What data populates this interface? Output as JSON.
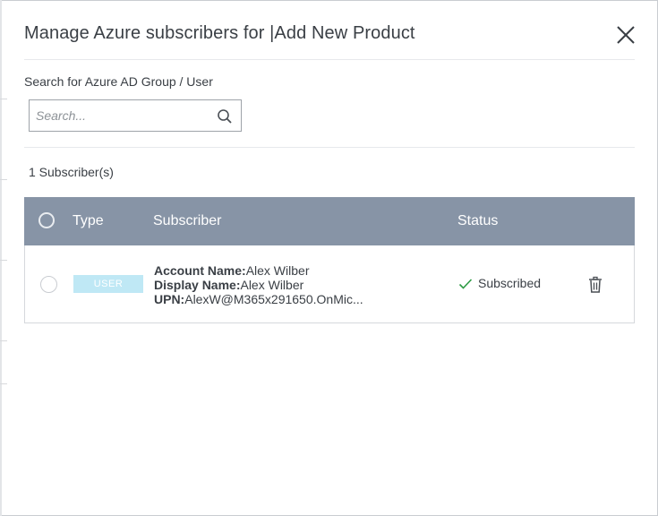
{
  "dialog": {
    "title": "Manage Azure subscribers for |Add New Product"
  },
  "search": {
    "label": "Search for Azure AD Group / User",
    "placeholder": "Search...",
    "value": ""
  },
  "subscribers": {
    "count_label": "1 Subscriber(s)",
    "columns": {
      "type": "Type",
      "subscriber": "Subscriber",
      "status": "Status"
    },
    "rows": [
      {
        "type_badge": "USER",
        "account_name_label": "Account Name:",
        "account_name": "Alex Wilber",
        "display_name_label": "Display Name:",
        "display_name": "Alex Wilber",
        "upn_label": "UPN:",
        "upn": "AlexW@M365x291650.OnMic...",
        "status": "Subscribed"
      }
    ]
  },
  "icons": {
    "close": "close-icon",
    "search": "search-icon",
    "status_check": "check-icon",
    "delete": "trash-icon"
  },
  "colors": {
    "table_header": "#8794a6",
    "user_badge": "#bfe8f5",
    "status_check": "#2e9b45",
    "text": "#3a3f45"
  }
}
